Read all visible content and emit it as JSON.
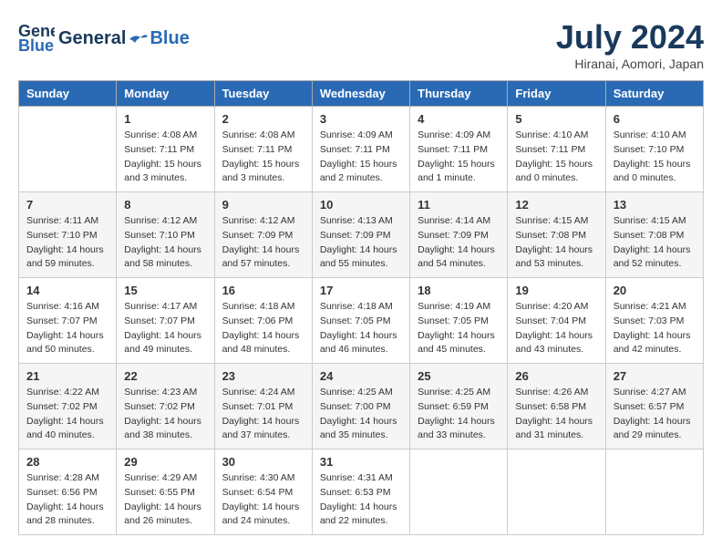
{
  "header": {
    "logo_general": "General",
    "logo_blue": "Blue",
    "month_title": "July 2024",
    "location": "Hiranai, Aomori, Japan"
  },
  "days_of_week": [
    "Sunday",
    "Monday",
    "Tuesday",
    "Wednesday",
    "Thursday",
    "Friday",
    "Saturday"
  ],
  "weeks": [
    [
      {
        "day": "",
        "info": ""
      },
      {
        "day": "1",
        "info": "Sunrise: 4:08 AM\nSunset: 7:11 PM\nDaylight: 15 hours\nand 3 minutes."
      },
      {
        "day": "2",
        "info": "Sunrise: 4:08 AM\nSunset: 7:11 PM\nDaylight: 15 hours\nand 3 minutes."
      },
      {
        "day": "3",
        "info": "Sunrise: 4:09 AM\nSunset: 7:11 PM\nDaylight: 15 hours\nand 2 minutes."
      },
      {
        "day": "4",
        "info": "Sunrise: 4:09 AM\nSunset: 7:11 PM\nDaylight: 15 hours\nand 1 minute."
      },
      {
        "day": "5",
        "info": "Sunrise: 4:10 AM\nSunset: 7:11 PM\nDaylight: 15 hours\nand 0 minutes."
      },
      {
        "day": "6",
        "info": "Sunrise: 4:10 AM\nSunset: 7:10 PM\nDaylight: 15 hours\nand 0 minutes."
      }
    ],
    [
      {
        "day": "7",
        "info": "Sunrise: 4:11 AM\nSunset: 7:10 PM\nDaylight: 14 hours\nand 59 minutes."
      },
      {
        "day": "8",
        "info": "Sunrise: 4:12 AM\nSunset: 7:10 PM\nDaylight: 14 hours\nand 58 minutes."
      },
      {
        "day": "9",
        "info": "Sunrise: 4:12 AM\nSunset: 7:09 PM\nDaylight: 14 hours\nand 57 minutes."
      },
      {
        "day": "10",
        "info": "Sunrise: 4:13 AM\nSunset: 7:09 PM\nDaylight: 14 hours\nand 55 minutes."
      },
      {
        "day": "11",
        "info": "Sunrise: 4:14 AM\nSunset: 7:09 PM\nDaylight: 14 hours\nand 54 minutes."
      },
      {
        "day": "12",
        "info": "Sunrise: 4:15 AM\nSunset: 7:08 PM\nDaylight: 14 hours\nand 53 minutes."
      },
      {
        "day": "13",
        "info": "Sunrise: 4:15 AM\nSunset: 7:08 PM\nDaylight: 14 hours\nand 52 minutes."
      }
    ],
    [
      {
        "day": "14",
        "info": "Sunrise: 4:16 AM\nSunset: 7:07 PM\nDaylight: 14 hours\nand 50 minutes."
      },
      {
        "day": "15",
        "info": "Sunrise: 4:17 AM\nSunset: 7:07 PM\nDaylight: 14 hours\nand 49 minutes."
      },
      {
        "day": "16",
        "info": "Sunrise: 4:18 AM\nSunset: 7:06 PM\nDaylight: 14 hours\nand 48 minutes."
      },
      {
        "day": "17",
        "info": "Sunrise: 4:18 AM\nSunset: 7:05 PM\nDaylight: 14 hours\nand 46 minutes."
      },
      {
        "day": "18",
        "info": "Sunrise: 4:19 AM\nSunset: 7:05 PM\nDaylight: 14 hours\nand 45 minutes."
      },
      {
        "day": "19",
        "info": "Sunrise: 4:20 AM\nSunset: 7:04 PM\nDaylight: 14 hours\nand 43 minutes."
      },
      {
        "day": "20",
        "info": "Sunrise: 4:21 AM\nSunset: 7:03 PM\nDaylight: 14 hours\nand 42 minutes."
      }
    ],
    [
      {
        "day": "21",
        "info": "Sunrise: 4:22 AM\nSunset: 7:02 PM\nDaylight: 14 hours\nand 40 minutes."
      },
      {
        "day": "22",
        "info": "Sunrise: 4:23 AM\nSunset: 7:02 PM\nDaylight: 14 hours\nand 38 minutes."
      },
      {
        "day": "23",
        "info": "Sunrise: 4:24 AM\nSunset: 7:01 PM\nDaylight: 14 hours\nand 37 minutes."
      },
      {
        "day": "24",
        "info": "Sunrise: 4:25 AM\nSunset: 7:00 PM\nDaylight: 14 hours\nand 35 minutes."
      },
      {
        "day": "25",
        "info": "Sunrise: 4:25 AM\nSunset: 6:59 PM\nDaylight: 14 hours\nand 33 minutes."
      },
      {
        "day": "26",
        "info": "Sunrise: 4:26 AM\nSunset: 6:58 PM\nDaylight: 14 hours\nand 31 minutes."
      },
      {
        "day": "27",
        "info": "Sunrise: 4:27 AM\nSunset: 6:57 PM\nDaylight: 14 hours\nand 29 minutes."
      }
    ],
    [
      {
        "day": "28",
        "info": "Sunrise: 4:28 AM\nSunset: 6:56 PM\nDaylight: 14 hours\nand 28 minutes."
      },
      {
        "day": "29",
        "info": "Sunrise: 4:29 AM\nSunset: 6:55 PM\nDaylight: 14 hours\nand 26 minutes."
      },
      {
        "day": "30",
        "info": "Sunrise: 4:30 AM\nSunset: 6:54 PM\nDaylight: 14 hours\nand 24 minutes."
      },
      {
        "day": "31",
        "info": "Sunrise: 4:31 AM\nSunset: 6:53 PM\nDaylight: 14 hours\nand 22 minutes."
      },
      {
        "day": "",
        "info": ""
      },
      {
        "day": "",
        "info": ""
      },
      {
        "day": "",
        "info": ""
      }
    ]
  ]
}
